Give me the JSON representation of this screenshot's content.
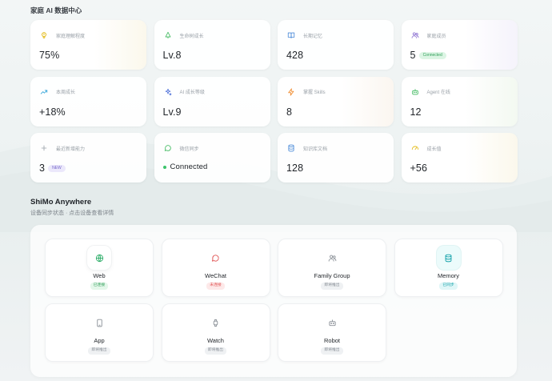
{
  "page": {
    "title": "家庭 AI 数据中心"
  },
  "stats": [
    {
      "id": "understanding",
      "label": "家庭理解程度",
      "value": "75%",
      "icon": "lightbulb-icon",
      "color": "#e0b400",
      "tint": "yellow"
    },
    {
      "id": "growth",
      "label": "生命树成长",
      "value": "Lv.8",
      "icon": "tree-icon",
      "color": "#3cb85c",
      "tint": ""
    },
    {
      "id": "memory",
      "label": "长期记忆",
      "value": "428",
      "icon": "book-icon",
      "color": "#4a8ad8",
      "tint": ""
    },
    {
      "id": "members",
      "label": "家庭成员",
      "value": "5",
      "icon": "users-icon",
      "color": "#8a6ed0",
      "tint": "purple",
      "badge": "Connected"
    },
    {
      "id": "weekly",
      "label": "本周成长",
      "value": "+18%",
      "icon": "trend-up-icon",
      "color": "#2fa3d8",
      "tint": ""
    },
    {
      "id": "ai-level",
      "label": "AI 成长等级",
      "value": "Lv.9",
      "icon": "sparkle-icon",
      "color": "#4a6ed8",
      "tint": ""
    },
    {
      "id": "skills",
      "label": "掌握 Skills",
      "value": "8",
      "icon": "bolt-icon",
      "color": "#f08a2c",
      "tint": "orange"
    },
    {
      "id": "agent",
      "label": "Agent 在线",
      "value": "12",
      "icon": "robot-icon",
      "color": "#3cb85c",
      "tint": "green"
    },
    {
      "id": "new-ability",
      "label": "最近新增能力",
      "value": "3",
      "icon": "plus-icon",
      "color": "#9aa1a8",
      "tint": "",
      "badge": "NEW"
    },
    {
      "id": "wechat-sync",
      "label": "微信同步",
      "value": "Connected",
      "icon": "chat-icon",
      "color": "#3cb85c",
      "tint": "",
      "dot": true
    },
    {
      "id": "docs",
      "label": "知识库文档",
      "value": "128",
      "icon": "database-icon",
      "color": "#4a8ad8",
      "tint": ""
    },
    {
      "id": "growth-value",
      "label": "成长值",
      "value": "+56",
      "icon": "gauge-icon",
      "color": "#e0b400",
      "tint": "yellow"
    }
  ],
  "anywhere": {
    "title": "ShiMo Anywhere",
    "subtitle": "设备同步状态 · 点击设备查看详情"
  },
  "devices": [
    {
      "id": "web",
      "name": "Web",
      "status": "已连接",
      "statusType": "green",
      "icon": "globe-icon",
      "color": "#2fae6a",
      "style": "glow"
    },
    {
      "id": "wechat",
      "name": "WeChat",
      "status": "未连接",
      "statusType": "red",
      "icon": "chat-icon",
      "color": "#e05353",
      "style": ""
    },
    {
      "id": "family",
      "name": "Family Group",
      "status": "即将推出",
      "statusType": "gray",
      "icon": "users-icon",
      "color": "#8b9198",
      "style": ""
    },
    {
      "id": "memory",
      "name": "Memory",
      "status": "已同步",
      "statusType": "cyan",
      "icon": "database-icon",
      "color": "#17a3ab",
      "style": "glow-cyan"
    },
    {
      "id": "app",
      "name": "App",
      "status": "即将推出",
      "statusType": "gray",
      "icon": "phone-icon",
      "color": "#8b9198",
      "style": ""
    },
    {
      "id": "watch",
      "name": "Watch",
      "status": "即将推出",
      "statusType": "gray",
      "icon": "watch-icon",
      "color": "#8b9198",
      "style": ""
    },
    {
      "id": "robot",
      "name": "Robot",
      "status": "即将推出",
      "statusType": "gray",
      "icon": "robot-icon",
      "color": "#8b9198",
      "style": ""
    }
  ]
}
